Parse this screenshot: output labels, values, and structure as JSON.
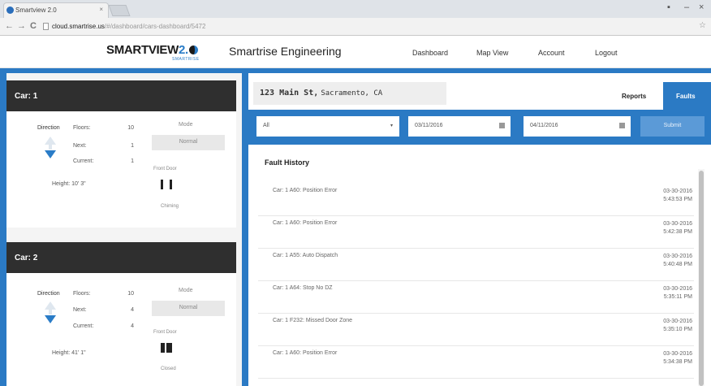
{
  "browser": {
    "tab_title": "Smartview 2.0",
    "tab_close": "×",
    "min_glyph": "–",
    "close_glyph": "×",
    "back_glyph": "←",
    "forward_glyph": "→",
    "reload_glyph": "C",
    "star_glyph": "☆",
    "url_host": "cloud.smartrise.us",
    "url_path": "/#/dashboard/cars-dashboard/5472"
  },
  "header": {
    "logo_main": "SMARTVIEW",
    "logo_version": "2.",
    "logo_sub": "SMARTRISE",
    "company": "Smartrise Engineering",
    "nav": [
      "Dashboard",
      "Map View",
      "Account",
      "Logout"
    ]
  },
  "cars": [
    {
      "title": "Car: 1",
      "direction_label": "Direction",
      "floors_label": "Floors:",
      "floors_value": "10",
      "next_label": "Next:",
      "next_value": "1",
      "current_label": "Current:",
      "current_value": "1",
      "height_label": "Height: 10' 3\"",
      "mode_label": "Mode",
      "mode_value": "Normal",
      "door_label": "Front Door",
      "door_state": "Chiming"
    },
    {
      "title": "Car: 2",
      "direction_label": "Direction",
      "floors_label": "Floors:",
      "floors_value": "10",
      "next_label": "Next:",
      "next_value": "4",
      "current_label": "Current:",
      "current_value": "4",
      "height_label": "Height: 41' 1\"",
      "mode_label": "Mode",
      "mode_value": "Normal",
      "door_label": "Front Door",
      "door_state": "Closed"
    }
  ],
  "location": {
    "street": "123 Main St,",
    "city": "Sacramento, CA"
  },
  "tabs": {
    "reports": "Reports",
    "faults": "Faults"
  },
  "filters": {
    "car_select": "All",
    "caret_glyph": "▾",
    "start_date": "03/11/2016",
    "end_date": "04/11/2016",
    "submit": "Submit"
  },
  "fault_history": {
    "title": "Fault History",
    "rows": [
      {
        "desc": "Car: 1 A60: Position Error",
        "date": "03-30-2016",
        "time": "5:43:53 PM"
      },
      {
        "desc": "Car: 1 A60: Position Error",
        "date": "03-30-2016",
        "time": "5:42:38 PM"
      },
      {
        "desc": "Car: 1 A55: Auto Dispatch",
        "date": "03-30-2016",
        "time": "5:40:48 PM"
      },
      {
        "desc": "Car: 1 A64: Stop No DZ",
        "date": "03-30-2016",
        "time": "5:35:11 PM"
      },
      {
        "desc": "Car: 1 F232: Missed Door Zone",
        "date": "03-30-2016",
        "time": "5:35:10 PM"
      },
      {
        "desc": "Car: 1 A60: Position Error",
        "date": "03-30-2016",
        "time": "5:34:38 PM"
      }
    ]
  },
  "colors": {
    "brand_blue": "#2b7ac4",
    "header_dark": "#2f2f2f"
  }
}
